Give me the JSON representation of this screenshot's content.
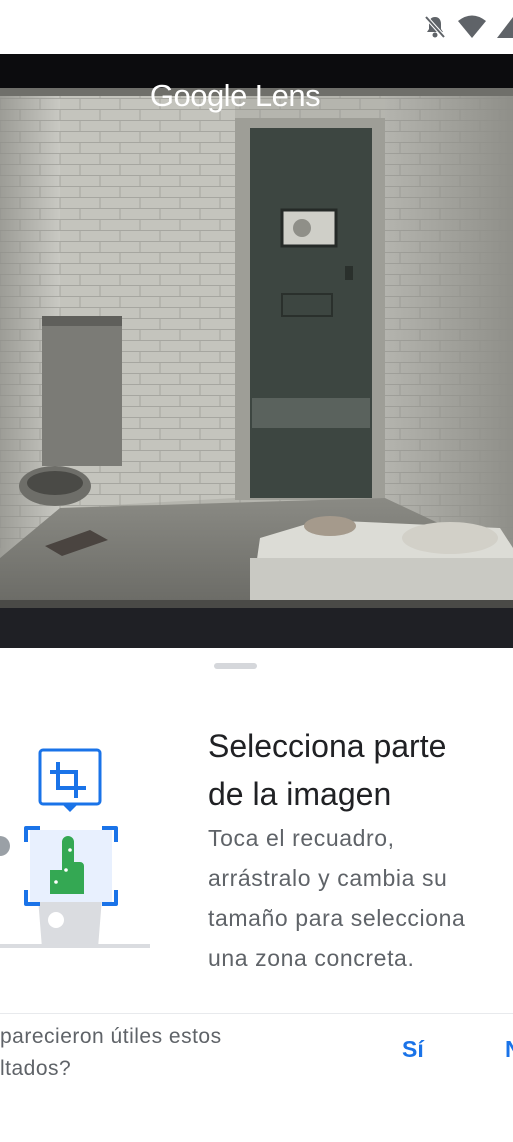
{
  "viewer": {
    "app_title": "Google Lens"
  },
  "sheet": {
    "title_line1": "Selecciona parte",
    "title_line2": "de la imagen",
    "desc_line1": "Toca el recuadro,",
    "desc_line2": "arrástralo y cambia su",
    "desc_line3": "tamaño para selecciona",
    "desc_line4": "una zona concreta."
  },
  "feedback": {
    "question_line1": "parecieron útiles estos",
    "question_line2": "ltados?",
    "yes_label": "Sí",
    "no_label": "N"
  },
  "colors": {
    "accent": "#1a73e8",
    "success": "#34a853",
    "viewer_bg": "#1f2025"
  },
  "icons": [
    "do-not-disturb-icon",
    "wifi-icon",
    "signal-icon",
    "crop-icon",
    "hand-icon"
  ]
}
